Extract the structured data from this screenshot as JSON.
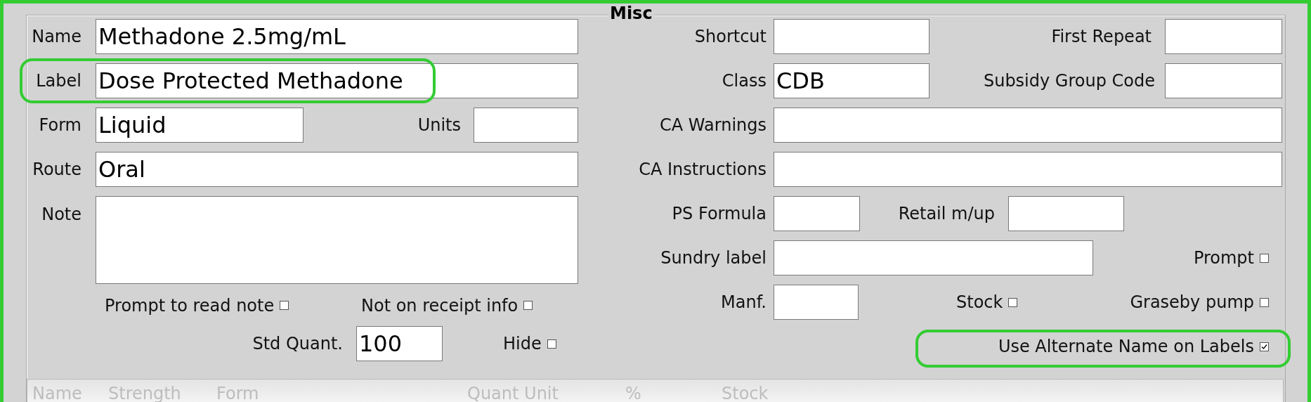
{
  "section_title": "Misc",
  "name": {
    "label": "Name",
    "value": "Methadone 2.5mg/mL"
  },
  "label": {
    "label": "Label",
    "value": "Dose Protected Methadone",
    "highlighted": true
  },
  "form": {
    "label": "Form",
    "value": "Liquid"
  },
  "units": {
    "label": "Units"
  },
  "route": {
    "label": "Route",
    "value": "Oral"
  },
  "note": {
    "label": "Note"
  },
  "prompt_to_read_note": {
    "label": "Prompt to read note",
    "checked": false
  },
  "not_on_receipt_info": {
    "label": "Not on receipt info",
    "checked": false
  },
  "std_quant": {
    "label": "Std Quant.",
    "value": "100"
  },
  "hide": {
    "label": "Hide",
    "checked": false
  },
  "shortcut": {
    "label": "Shortcut"
  },
  "first_repeat": {
    "label": "First Repeat"
  },
  "class": {
    "label": "Class",
    "value": "CDB"
  },
  "subsidy_group_code": {
    "label": "Subsidy Group Code"
  },
  "ca_warnings": {
    "label": "CA Warnings"
  },
  "ca_instructions": {
    "label": "CA Instructions"
  },
  "ps_formula": {
    "label": "PS Formula"
  },
  "retail_markup": {
    "label": "Retail m/up"
  },
  "sundry_label": {
    "label": "Sundry label"
  },
  "prompt": {
    "label": "Prompt",
    "checked": false
  },
  "manf": {
    "label": "Manf."
  },
  "stock": {
    "label": "Stock",
    "checked": false
  },
  "graseby_pump": {
    "label": "Graseby pump",
    "checked": false
  },
  "use_alternate_name": {
    "label": "Use Alternate Name on Labels",
    "checked": true,
    "highlighted": true
  },
  "table": {
    "columns": [
      "Name",
      "Strength",
      "Form",
      "Quant Unit",
      "%",
      "Stock"
    ]
  }
}
